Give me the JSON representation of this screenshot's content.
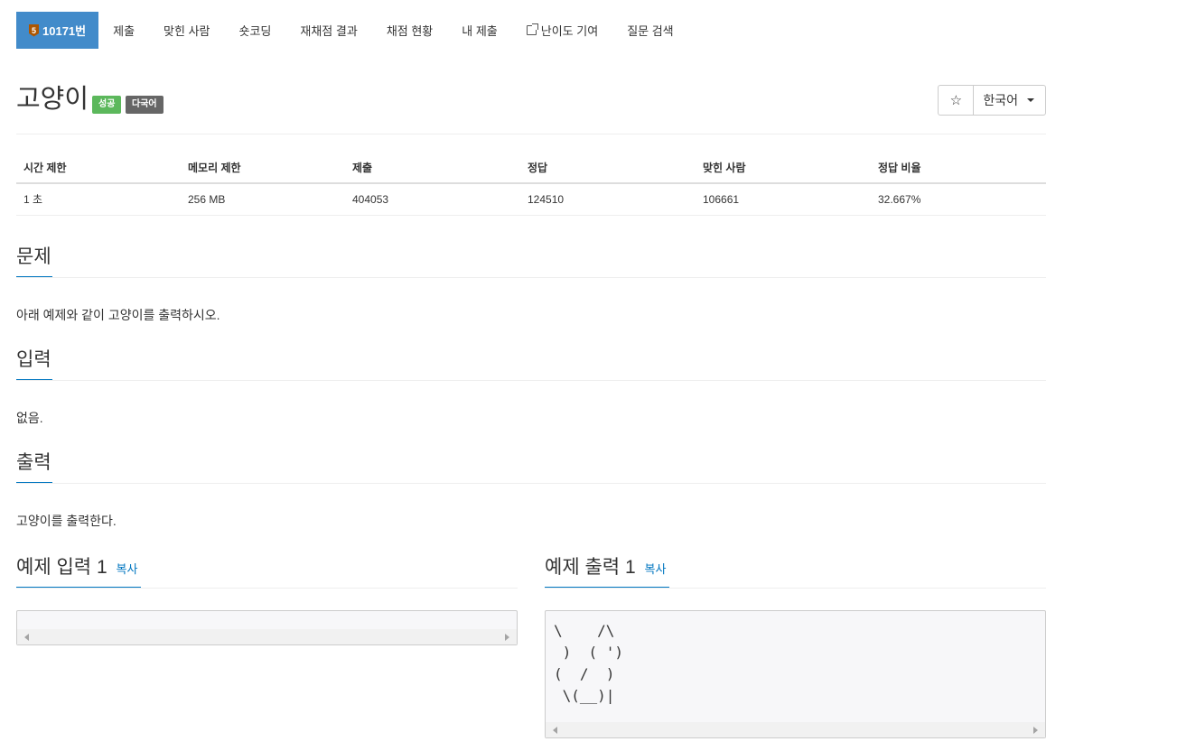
{
  "nav": {
    "tier": "5",
    "problem_label": "10171번",
    "items": [
      "제출",
      "맞힌 사람",
      "숏코딩",
      "재채점 결과",
      "채점 현황",
      "내 제출",
      "난이도 기여",
      "질문 검색"
    ]
  },
  "problem": {
    "title": "고양이",
    "badge_success": "성공",
    "badge_multi": "다국어",
    "star": "☆",
    "language": "한국어"
  },
  "stats": {
    "headers": [
      "시간 제한",
      "메모리 제한",
      "제출",
      "정답",
      "맞힌 사람",
      "정답 비율"
    ],
    "values": [
      "1 초",
      "256 MB",
      "404053",
      "124510",
      "106661",
      "32.667%"
    ]
  },
  "sections": {
    "problem": {
      "heading": "문제",
      "text": "아래 예제와 같이 고양이를 출력하시오."
    },
    "input": {
      "heading": "입력",
      "text": "없음."
    },
    "output": {
      "heading": "출력",
      "text": "고양이를 출력한다."
    }
  },
  "samples": {
    "input_heading": "예제 입력 1",
    "output_heading": "예제 출력 1",
    "copy_label": "복사",
    "input_text": "",
    "output_text": "\\    /\\\n )  ( ')\n(  /  )\n \\(__)|"
  },
  "colors": {
    "primary": "#428bca",
    "tier_bronze": "#ad5600",
    "success": "#5cb85c",
    "link": "#0076c0"
  }
}
